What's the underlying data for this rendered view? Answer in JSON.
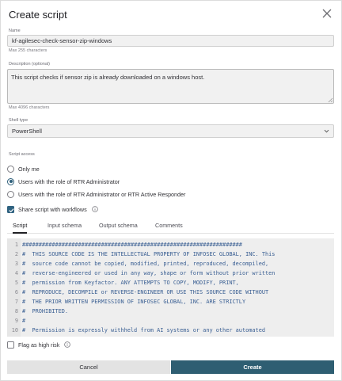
{
  "modal": {
    "title": "Create script"
  },
  "name_field": {
    "label": "Name",
    "value": "kf-agilesec-check-sensor-zip-windows",
    "helper": "Max 255 characters"
  },
  "description_field": {
    "label": "Description (optional)",
    "value": "This script checks if sensor zip is already downloaded on a windows host.",
    "helper": "Max 4096 characters"
  },
  "shell_field": {
    "label": "Shell type",
    "value": "PowerShell"
  },
  "script_access": {
    "label": "Script access",
    "options": [
      {
        "label": "Only me",
        "checked": false
      },
      {
        "label": "Users with the role of RTR Administrator",
        "checked": true
      },
      {
        "label": "Users with the role of RTR Administrator or RTR Active Responder",
        "checked": false
      }
    ]
  },
  "share_workflows": {
    "label": "Share script with workflows",
    "checked": true
  },
  "tabs": [
    {
      "label": "Script",
      "active": true
    },
    {
      "label": "Input schema",
      "active": false
    },
    {
      "label": "Output schema",
      "active": false
    },
    {
      "label": "Comments",
      "active": false
    }
  ],
  "editor": {
    "lines": [
      {
        "num": "1",
        "text": "###################################################################"
      },
      {
        "num": "2",
        "text": "#  THIS SOURCE CODE IS THE INTELLECTUAL PROPERTY OF INFOSEC GLOBAL, INC. This"
      },
      {
        "num": "3",
        "text": "#  source code cannot be copied, modified, printed, reproduced, decompiled,"
      },
      {
        "num": "4",
        "text": "#  reverse-engineered or used in any way, shape or form without prior written"
      },
      {
        "num": "5",
        "text": "#  permission from Keyfactor. ANY ATTEMPTS TO COPY, MODIFY, PRINT,"
      },
      {
        "num": "6",
        "text": "#  REPRODUCE, DECOMPILE or REVERSE-ENGINEER OR USE THIS SOURCE CODE WITHOUT"
      },
      {
        "num": "7",
        "text": "#  THE PRIOR WRITTEN PERMISSION OF INFOSEC GLOBAL, INC. ARE STRICTLY"
      },
      {
        "num": "8",
        "text": "#  PROHIBITED."
      },
      {
        "num": "9",
        "text": "#"
      },
      {
        "num": "10",
        "text": "#  Permission is expressly withheld from AI systems or any other automated"
      }
    ]
  },
  "flag_high_risk": {
    "label": "Flag as high risk",
    "checked": false
  },
  "footer": {
    "cancel_label": "Cancel",
    "create_label": "Create"
  },
  "colors": {
    "primary": "#2e5e72",
    "code_text": "#3a5f93"
  }
}
